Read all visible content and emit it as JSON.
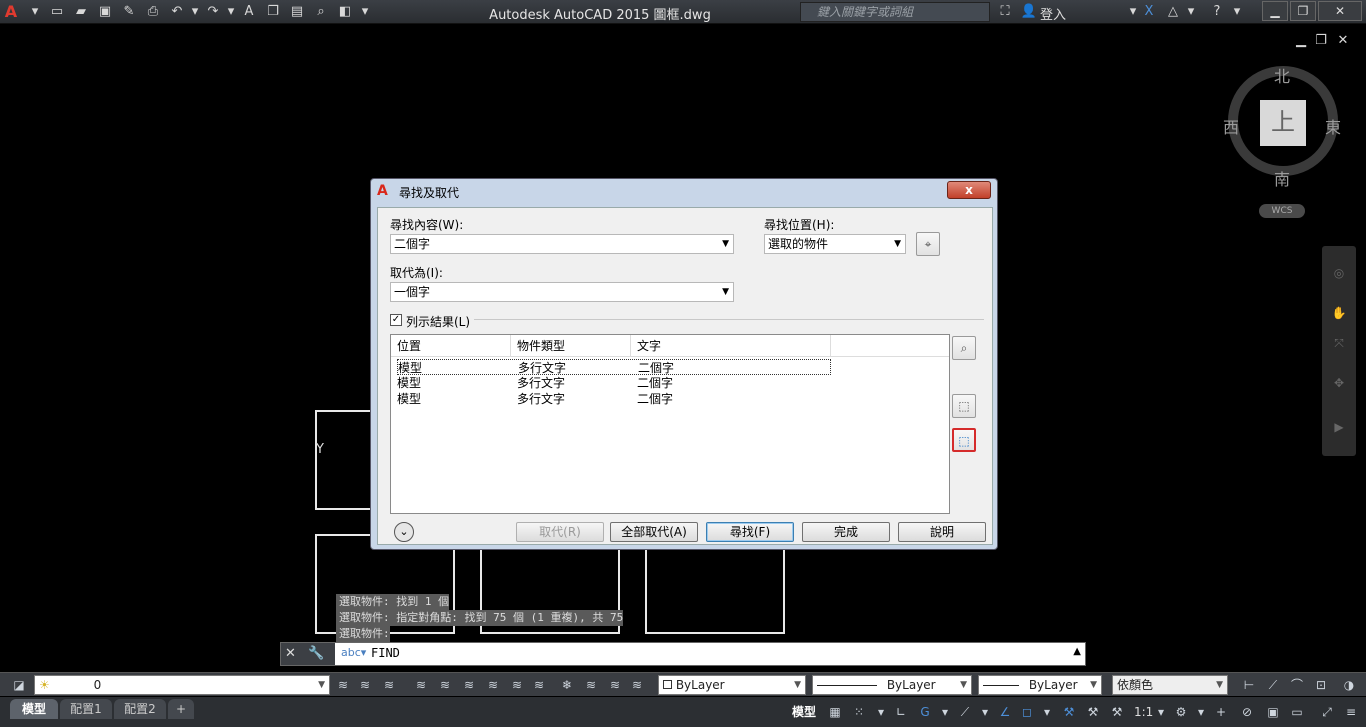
{
  "app": {
    "title": "Autodesk AutoCAD 2015    圖框.dwg",
    "search_placeholder": "鍵入關鍵字或詞組",
    "login": "登入"
  },
  "viewcube": {
    "north": "北",
    "south": "南",
    "east": "東",
    "west": "西",
    "face": "上",
    "wcs": "WCS"
  },
  "dialog": {
    "title": "尋找及取代",
    "close": "x",
    "find_label": "尋找內容(W):",
    "find_value": "二個字",
    "replace_label": "取代為(I):",
    "replace_value": "一個字",
    "location_label": "尋找位置(H):",
    "location_value": "選取的物件",
    "list_results_label": "列示結果(L)",
    "list_results_checked": true,
    "columns": [
      "位置",
      "物件類型",
      "文字"
    ],
    "rows": [
      [
        "模型",
        "多行文字",
        "二個字"
      ],
      [
        "模型",
        "多行文字",
        "二個字"
      ],
      [
        "模型",
        "多行文字",
        "二個字"
      ]
    ],
    "buttons": {
      "replace": "取代(R)",
      "replace_all": "全部取代(A)",
      "find": "尋找(F)",
      "done": "完成",
      "help": "說明"
    }
  },
  "command": {
    "history": [
      "選取物件: 找到 1 個",
      "選取物件: 指定對角點: 找到 75 個 (1 重複), 共 75",
      "選取物件:"
    ],
    "current": "FIND"
  },
  "properties": {
    "layer": "0",
    "color": "ByLayer",
    "linetype": "ByLayer",
    "lineweight": "ByLayer",
    "plotstyle": "依顏色"
  },
  "status": {
    "tabs": [
      "模型",
      "配置1",
      "配置2"
    ],
    "model_label": "模型",
    "scale": "1:1"
  },
  "canvas": {
    "y_axis_label": "Y"
  }
}
